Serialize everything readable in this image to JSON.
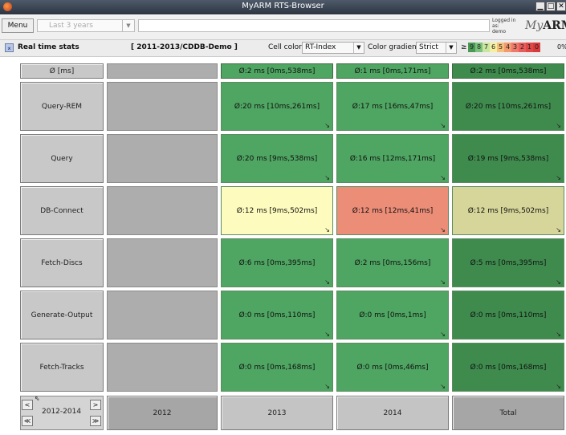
{
  "window": {
    "title": "MyARM RTS-Browser",
    "buttons": [
      "▁",
      "□",
      "✕"
    ]
  },
  "toolbar": {
    "menu_label": "Menu",
    "period_value": "Last 3 years",
    "period_arrow": "▼",
    "login_line1": "Logged in as:",
    "login_line2": "demo",
    "logo_prefix": "My",
    "logo_suffix": "ARM"
  },
  "statsbar": {
    "rt_icon": "⌅",
    "realtime_label": "Real time stats",
    "context_label": "[ 2011-2013/CDDB-Demo ]",
    "cell_color_label": "Cell color",
    "cell_color_value": "RT-Index",
    "color_gradient_label": "Color gradient",
    "color_gradient_value": "Strict",
    "select_arrow": "▼",
    "ge_symbol": "≥",
    "legend": [
      {
        "v": "9",
        "c": "#4a9a55"
      },
      {
        "v": "8",
        "c": "#7cc27c"
      },
      {
        "v": "7",
        "c": "#c8e6a0"
      },
      {
        "v": "6",
        "c": "#f5f0a0"
      },
      {
        "v": "5",
        "c": "#f6c07a"
      },
      {
        "v": "4",
        "c": "#f39a6e"
      },
      {
        "v": "3",
        "c": "#ef7a6a"
      },
      {
        "v": "2",
        "c": "#e85c5c"
      },
      {
        "v": "1",
        "c": "#e04848"
      },
      {
        "v": "0",
        "c": "#d93a3a"
      }
    ],
    "pct": "0%"
  },
  "table": {
    "corner_header": "Ø [ms]",
    "top_values": [
      "Ø:2 ms [0ms,538ms]",
      "Ø:1 ms [0ms,171ms]",
      "Ø:2 ms [0ms,538ms]"
    ],
    "rows": [
      {
        "label": "Query-REM",
        "cells": [
          "Ø:20 ms [10ms,261ms]",
          "Ø:17 ms [16ms,47ms]",
          "Ø:20 ms [10ms,261ms]"
        ],
        "colors": [
          "#4fa562",
          "#4fa562",
          "#3f8b4e"
        ]
      },
      {
        "label": "Query",
        "cells": [
          "Ø:20 ms [9ms,538ms]",
          "Ø:16 ms [12ms,171ms]",
          "Ø:19 ms [9ms,538ms]"
        ],
        "colors": [
          "#4fa562",
          "#4fa562",
          "#3f8b4e"
        ]
      },
      {
        "label": "DB-Connect",
        "cells": [
          "Ø:12 ms [9ms,502ms]",
          "Ø:12 ms [12ms,41ms]",
          "Ø:12 ms [9ms,502ms]"
        ],
        "colors": [
          "#fdfbbd",
          "#ec8d78",
          "#d6d69a"
        ]
      },
      {
        "label": "Fetch-Discs",
        "cells": [
          "Ø:6 ms [0ms,395ms]",
          "Ø:2 ms [0ms,156ms]",
          "Ø:5 ms [0ms,395ms]"
        ],
        "colors": [
          "#4fa562",
          "#4fa562",
          "#3f8b4e"
        ]
      },
      {
        "label": "Generate-Output",
        "cells": [
          "Ø:0 ms [0ms,110ms]",
          "Ø:0 ms [0ms,1ms]",
          "Ø:0 ms [0ms,110ms]"
        ],
        "colors": [
          "#4fa562",
          "#4fa562",
          "#3f8b4e"
        ]
      },
      {
        "label": "Fetch-Tracks",
        "cells": [
          "Ø:0 ms [0ms,168ms]",
          "Ø:0 ms [0ms,46ms]",
          "Ø:0 ms [0ms,168ms]"
        ],
        "colors": [
          "#4fa562",
          "#4fa562",
          "#3f8b4e"
        ]
      }
    ],
    "corner_arrow": "↘",
    "top_colors": [
      "#4fa562",
      "#4fa562",
      "#3f8b4e"
    ],
    "column_footers": [
      "2012",
      "2013",
      "2014",
      "Total"
    ],
    "nav": {
      "range_label": "2012-2014",
      "prev": "<",
      "next": ">",
      "first": "≪",
      "last": "≫",
      "corner_mark": "⇖"
    }
  }
}
